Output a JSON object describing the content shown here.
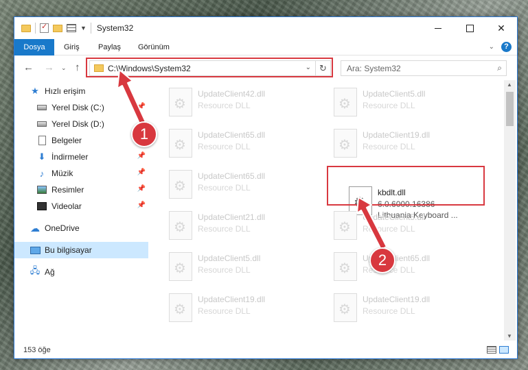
{
  "window": {
    "title": "System32",
    "controls": {
      "minimize": "",
      "maximize": "",
      "close": "✕"
    }
  },
  "ribbon": {
    "tabs": [
      "Dosya",
      "Giriş",
      "Paylaş",
      "Görünüm"
    ],
    "expand_chevron": "⌄",
    "help": "?"
  },
  "navigation": {
    "back": "←",
    "forward": "→",
    "recent": "⌄",
    "up": "↑"
  },
  "address": {
    "path": "C:\\Windows\\System32",
    "dropdown": "⌄",
    "refresh": "↻"
  },
  "search": {
    "placeholder": "Ara: System32",
    "icon": "⌕"
  },
  "sidebar": {
    "items": [
      {
        "label": "Hızlı erişim",
        "icon": "star-icon",
        "pinned": false
      },
      {
        "label": "Yerel Disk (C:)",
        "icon": "drive-icon",
        "pinned": true
      },
      {
        "label": "Yerel Disk (D:)",
        "icon": "drive-icon",
        "pinned": true
      },
      {
        "label": "Belgeler",
        "icon": "document-icon",
        "pinned": true
      },
      {
        "label": "İndirmeler",
        "icon": "download-icon",
        "pinned": true
      },
      {
        "label": "Müzik",
        "icon": "music-icon",
        "pinned": true
      },
      {
        "label": "Resimler",
        "icon": "pictures-icon",
        "pinned": true
      },
      {
        "label": "Videolar",
        "icon": "videos-icon",
        "pinned": true
      },
      {
        "label": "OneDrive",
        "icon": "cloud-icon",
        "pinned": false
      },
      {
        "label": "Bu bilgisayar",
        "icon": "computer-icon",
        "pinned": false
      },
      {
        "label": "Ağ",
        "icon": "network-icon",
        "pinned": false
      }
    ],
    "pin_glyph": "📌"
  },
  "files": [
    {
      "name": "UpdateClient42.dll",
      "type": "Resource DLL"
    },
    {
      "name": "UpdateClient5.dll",
      "type": "Resource DLL"
    },
    {
      "name": "UpdateClient65.dll",
      "type": "Resource DLL"
    },
    {
      "name": "UpdateClient19.dll",
      "type": "Resource DLL"
    },
    {
      "name": "UpdateClient65.dll",
      "type": "Resource DLL"
    },
    {
      "name": "kbdlt.dll",
      "version": "6.0.6000.16386",
      "description": "Lithuania Keyboard ...",
      "selected": true
    },
    {
      "name": "UpdateClient21.dll",
      "type": "Resource DLL"
    },
    {
      "name": "UpdateClient5.dll",
      "type": "Resource DLL"
    },
    {
      "name": "UpdateClient5.dll",
      "type": "Resource DLL"
    },
    {
      "name": "UpdateClient65.dll",
      "type": "Resource DLL"
    },
    {
      "name": "UpdateClient19.dll",
      "type": "Resource DLL"
    },
    {
      "name": "UpdateClient19.dll",
      "type": "Resource DLL"
    }
  ],
  "status": {
    "item_count": "153 öğe"
  },
  "annotations": {
    "step1": "1",
    "step2": "2",
    "color": "#d8383f"
  }
}
